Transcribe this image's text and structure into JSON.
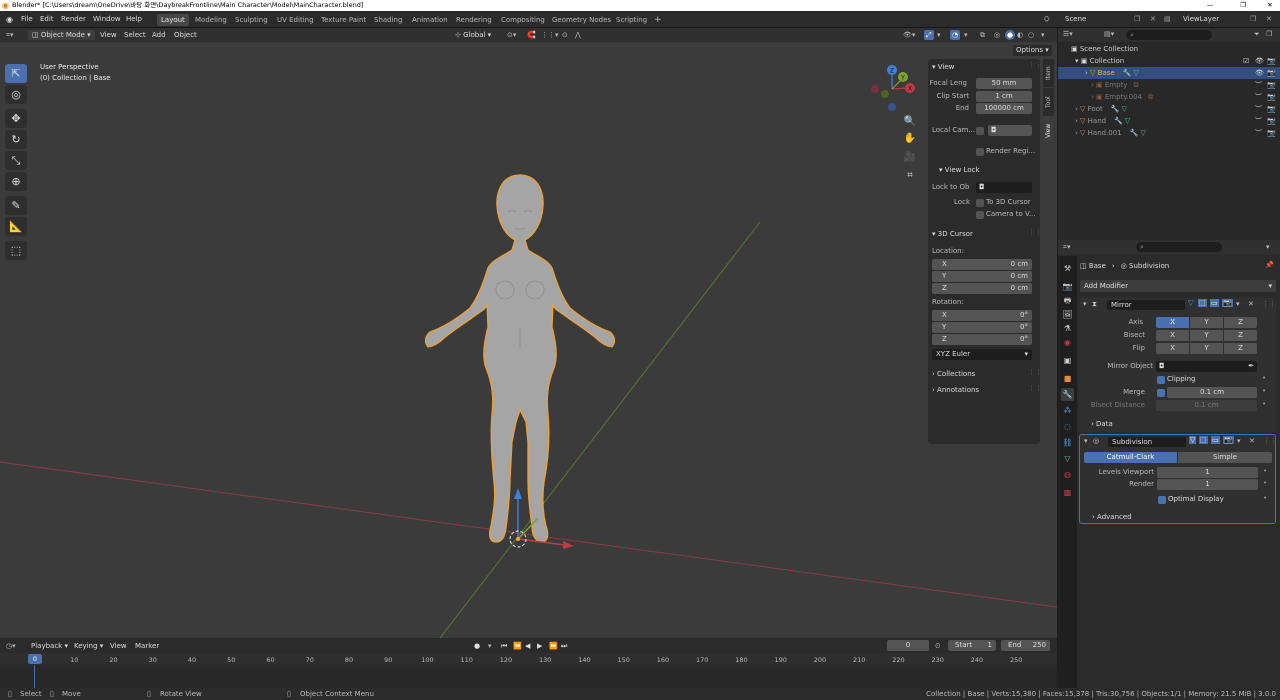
{
  "window": {
    "title": "Blender* [C:\\Users\\dream\\OneDrive\\바탕 화면\\DaybreakFrontline\\Main Character\\Model\\MainCharacter.blend]"
  },
  "topbar": {
    "menus": [
      "File",
      "Edit",
      "Render",
      "Window",
      "Help"
    ],
    "workspaces": [
      "Layout",
      "Modeling",
      "Sculpting",
      "UV Editing",
      "Texture Paint",
      "Shading",
      "Animation",
      "Rendering",
      "Compositing",
      "Geometry Nodes",
      "Scripting"
    ],
    "active_workspace": "Layout",
    "add_tab": "+",
    "scene_label": "Scene",
    "viewlayer_label": "ViewLayer"
  },
  "viewport_header": {
    "mode": "Object Mode",
    "menus": [
      "View",
      "Select",
      "Add",
      "Object"
    ],
    "orientation": "Global",
    "options": "Options"
  },
  "viewport": {
    "perspective": "User Perspective",
    "collection": "(0) Collection | Base"
  },
  "gizmo": {
    "x": "X",
    "y": "Y",
    "z": "Z"
  },
  "npanel": {
    "tabs": [
      "Item",
      "Tool",
      "View"
    ],
    "active_tab": "View",
    "view_section": "View",
    "focal_label": "Focal Leng",
    "focal_value": "50 mm",
    "clip_start_label": "Clip Start",
    "clip_start_value": "1 cm",
    "end_label": "End",
    "end_value": "100000 cm",
    "local_camera_label": "Local Cam...",
    "render_region": "Render Regi...",
    "view_lock_section": "View Lock",
    "lock_to_object_label": "Lock to Ob",
    "lock_label": "Lock",
    "to_3d_cursor": "To 3D Cursor",
    "camera_to_view": "Camera to V...",
    "cursor_section": "3D Cursor",
    "location_label": "Location:",
    "loc_x": "0 cm",
    "loc_y": "0 cm",
    "loc_z": "0 cm",
    "rotation_label": "Rotation:",
    "rot_x": "0°",
    "rot_y": "0°",
    "rot_z": "0°",
    "rotation_mode": "XYZ Euler",
    "collections_section": "Collections",
    "annotations_section": "Annotations",
    "axis_x": "X",
    "axis_y": "Y",
    "axis_z": "Z"
  },
  "outliner": {
    "rows": [
      {
        "label": "Scene Collection"
      },
      {
        "label": "Collection"
      },
      {
        "label": "Base"
      },
      {
        "label": "Empty"
      },
      {
        "label": "Empty.004"
      },
      {
        "label": "Foot"
      },
      {
        "label": "Hand"
      },
      {
        "label": "Hand.001"
      }
    ]
  },
  "properties": {
    "breadcrumb_object": "Base",
    "breadcrumb_modifier": "Subdivision",
    "add_modifier": "Add Modifier",
    "mirror": {
      "name": "Mirror",
      "axis_label": "Axis",
      "bisect_label": "Bisect",
      "flip_label": "Flip",
      "x": "X",
      "y": "Y",
      "z": "Z",
      "mirror_object_label": "Mirror Object",
      "clipping": "Clipping",
      "merge_label": "Merge",
      "merge_value": "0.1 cm",
      "bisect_distance_label": "Bisect Distance",
      "bisect_distance_value": "0.1 cm",
      "data_section": "Data"
    },
    "subdivision": {
      "name": "Subdivision",
      "catmull": "Catmull-Clark",
      "simple": "Simple",
      "levels_viewport_label": "Levels Viewport",
      "levels_viewport_value": "1",
      "render_label": "Render",
      "render_value": "1",
      "optimal_display": "Optimal Display",
      "advanced_section": "Advanced"
    }
  },
  "timeline": {
    "menus": [
      "Playback",
      "Keying",
      "View",
      "Marker"
    ],
    "current_frame": "0",
    "start_label": "Start",
    "start_value": "1",
    "end_label": "End",
    "end_value": "250",
    "ruler_current": "0",
    "ticks": [
      "10",
      "20",
      "30",
      "40",
      "50",
      "60",
      "70",
      "80",
      "90",
      "100",
      "110",
      "120",
      "130",
      "140",
      "150",
      "160",
      "170",
      "180",
      "190",
      "200",
      "210",
      "220",
      "230",
      "240",
      "250"
    ]
  },
  "statusbar": {
    "select": "Select",
    "move": "Move",
    "rotate": "Rotate View",
    "context_menu": "Object Context Menu",
    "stats": "Collection | Base | Verts:15,380 | Faces:15,378 | Tris:30,756 | Objects:1/1 | Memory: 21.5 MiB | 3.0.0"
  },
  "colors": {
    "accent": "#4a70b0",
    "selection_outline": "#f0a030",
    "x_axis": "#c0394a",
    "y_axis": "#7da22f",
    "z_axis": "#3e7fd8",
    "mesh_icon": "#57a0a0",
    "object_icon": "#e8893a"
  }
}
